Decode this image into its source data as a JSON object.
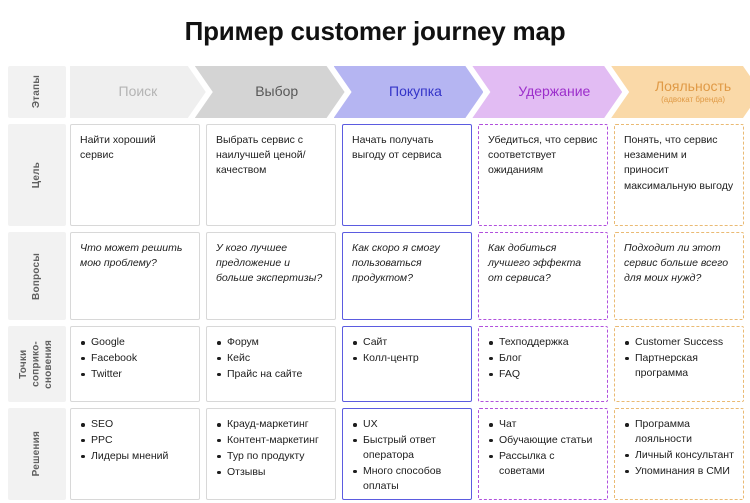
{
  "title": "Пример customer journey map",
  "rail_labels": {
    "stages": "Этапы",
    "goal": "Цель",
    "questions": "Вопросы",
    "touchpoints": "Точки\nсоприко-\nсновения",
    "solutions": "Решения"
  },
  "stages": [
    {
      "label": "Поиск",
      "sub": "",
      "fill": "#efefef",
      "text": "#b4b4b4",
      "key": "search"
    },
    {
      "label": "Выбор",
      "sub": "",
      "fill": "#d4d4d4",
      "text": "#585858",
      "key": "choice"
    },
    {
      "label": "Покупка",
      "sub": "",
      "fill": "#b5b5f2",
      "text": "#3434c8",
      "key": "purchase"
    },
    {
      "label": "Удержание",
      "sub": "",
      "fill": "#e2bcf3",
      "text": "#9c2ecb",
      "key": "retention"
    },
    {
      "label": "Лояльность",
      "sub": "(адвокат бренда)",
      "fill": "#fad9a8",
      "text": "#e09a46",
      "key": "loyalty"
    }
  ],
  "colors": {
    "accent_blue": "#5b5be0",
    "accent_purple": "#b150dd",
    "accent_orange": "#eaba73",
    "rail_bg": "#f2f2f2",
    "card_border": "#d8d8d8"
  },
  "rows": {
    "goal": {
      "label": "Цель",
      "cells": [
        {
          "style": "plain",
          "text": "Найти хороший сервис"
        },
        {
          "style": "plain",
          "text": "Выбрать сервис с наилучшей ценой/качеством"
        },
        {
          "style": "blue",
          "text": "Начать получать выгоду от сервиса"
        },
        {
          "style": "purple",
          "text": "Убедиться, что сервис соответствует ожиданиям"
        },
        {
          "style": "orange",
          "text": "Понять, что сервис незаменим и приносит максимальную выгоду"
        }
      ]
    },
    "questions": {
      "label": "Вопросы",
      "cells": [
        {
          "style": "plain",
          "text": "Что может решить мою проблему?"
        },
        {
          "style": "plain",
          "text": "У кого лучшее предложение и больше экспертизы?"
        },
        {
          "style": "blue",
          "text": "Как скоро я смогу пользоваться продуктом?"
        },
        {
          "style": "purple",
          "text": "Как добиться лучшего эффекта от сервиса?"
        },
        {
          "style": "orange",
          "text": "Подходит ли этот сервис больше всего для моих нужд?"
        }
      ]
    },
    "touchpoints": {
      "label": "Точки соприко-сновения",
      "cells": [
        {
          "style": "plain",
          "items": [
            "Google",
            "Facebook",
            "Twitter"
          ]
        },
        {
          "style": "plain",
          "items": [
            "Форум",
            "Кейс",
            "Прайс на сайте"
          ]
        },
        {
          "style": "blue",
          "items": [
            "Сайт",
            "Колл-центр"
          ]
        },
        {
          "style": "purple",
          "items": [
            "Техподдержка",
            "Блог",
            "FAQ"
          ]
        },
        {
          "style": "orange",
          "items": [
            "Customer Success",
            "Партнерская программа"
          ]
        }
      ]
    },
    "solutions": {
      "label": "Решения",
      "cells": [
        {
          "style": "plain",
          "items": [
            "SEO",
            "PPC",
            "Лидеры мнений"
          ]
        },
        {
          "style": "plain",
          "items": [
            "Крауд-маркетинг",
            "Контент-маркетинг",
            "Тур по продукту",
            "Отзывы"
          ]
        },
        {
          "style": "blue",
          "items": [
            "UX",
            "Быстрый ответ оператора",
            "Много способов оплаты"
          ]
        },
        {
          "style": "purple",
          "items": [
            "Чат",
            "Обучающие статьи",
            "Рассылка с советами"
          ]
        },
        {
          "style": "orange",
          "items": [
            "Программа лояльности",
            "Личный консультант",
            "Упоминания в СМИ"
          ]
        }
      ]
    }
  }
}
